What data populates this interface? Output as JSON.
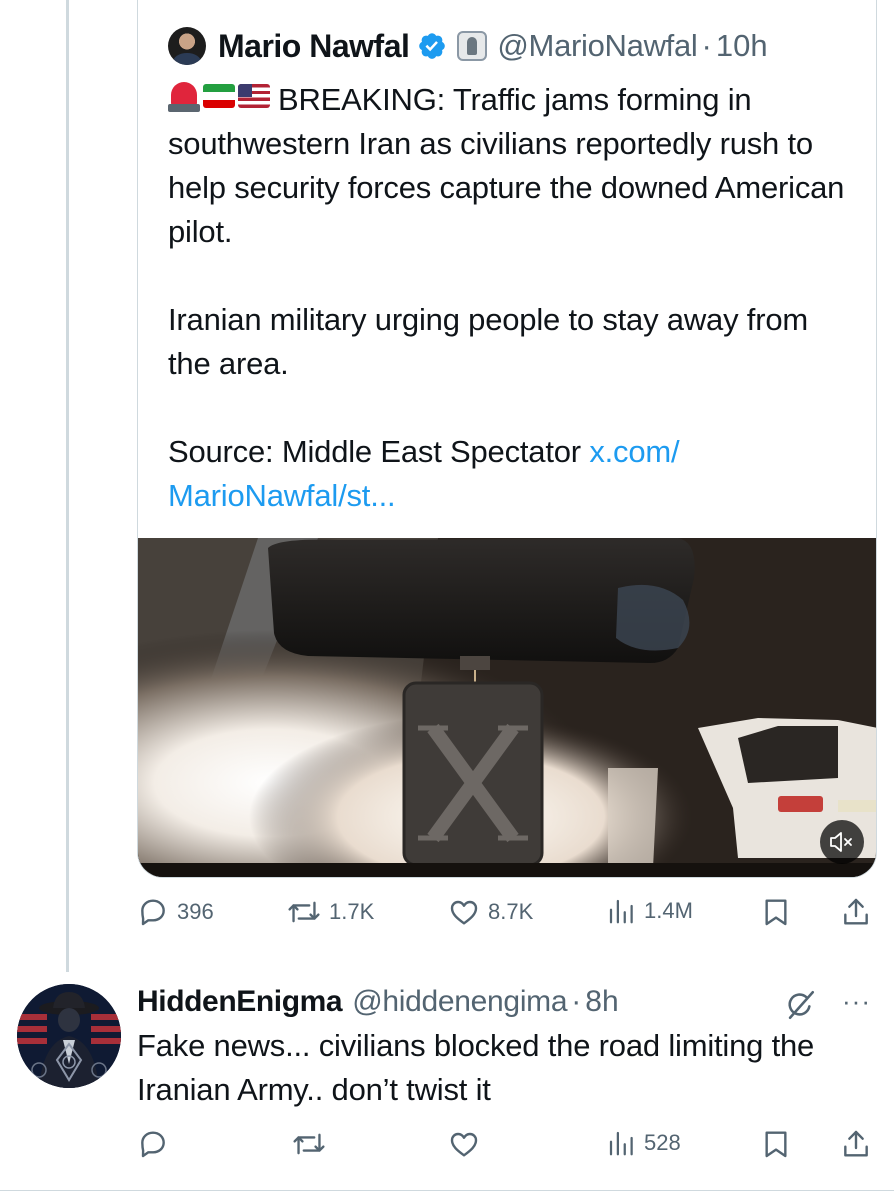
{
  "quoted_tweet": {
    "author_name": "Mario Nawfal",
    "handle": "@MarioNawfal",
    "separator": "·",
    "time": "10h",
    "emoji": [
      "police-light-emoji",
      "iran-flag-emoji",
      "us-flag-emoji"
    ],
    "text_line1": "BREAKING: Traffic jams forming in southwestern Iran as civilians reportedly rush to help security forces capture the downed American pilot.",
    "text_line2": "Iranian military urging people to stay away from the area.",
    "source_prefix": "Source: Middle East Spectator ",
    "source_link": "x.com/ MarioNawfal/st...",
    "media": {
      "type": "video",
      "muted": true,
      "mute_icon": "speaker-mute-icon"
    },
    "stats": {
      "replies": "396",
      "reposts": "1.7K",
      "likes": "8.7K",
      "views": "1.4M"
    }
  },
  "reply_tweet": {
    "author_name": "HiddenEnigma",
    "handle": "@hiddenengima",
    "separator": "·",
    "time": "8h",
    "text": "Fake news... civilians blocked the road limiting the Iranian Army.. don’t twist it",
    "stats": {
      "replies": "",
      "reposts": "",
      "likes": "",
      "views": "528"
    }
  },
  "colors": {
    "text_primary": "#0f1419",
    "text_secondary": "#536471",
    "link": "#1d9bf0",
    "border": "#cfd9de",
    "verified_badge": "#1d9bf0"
  }
}
